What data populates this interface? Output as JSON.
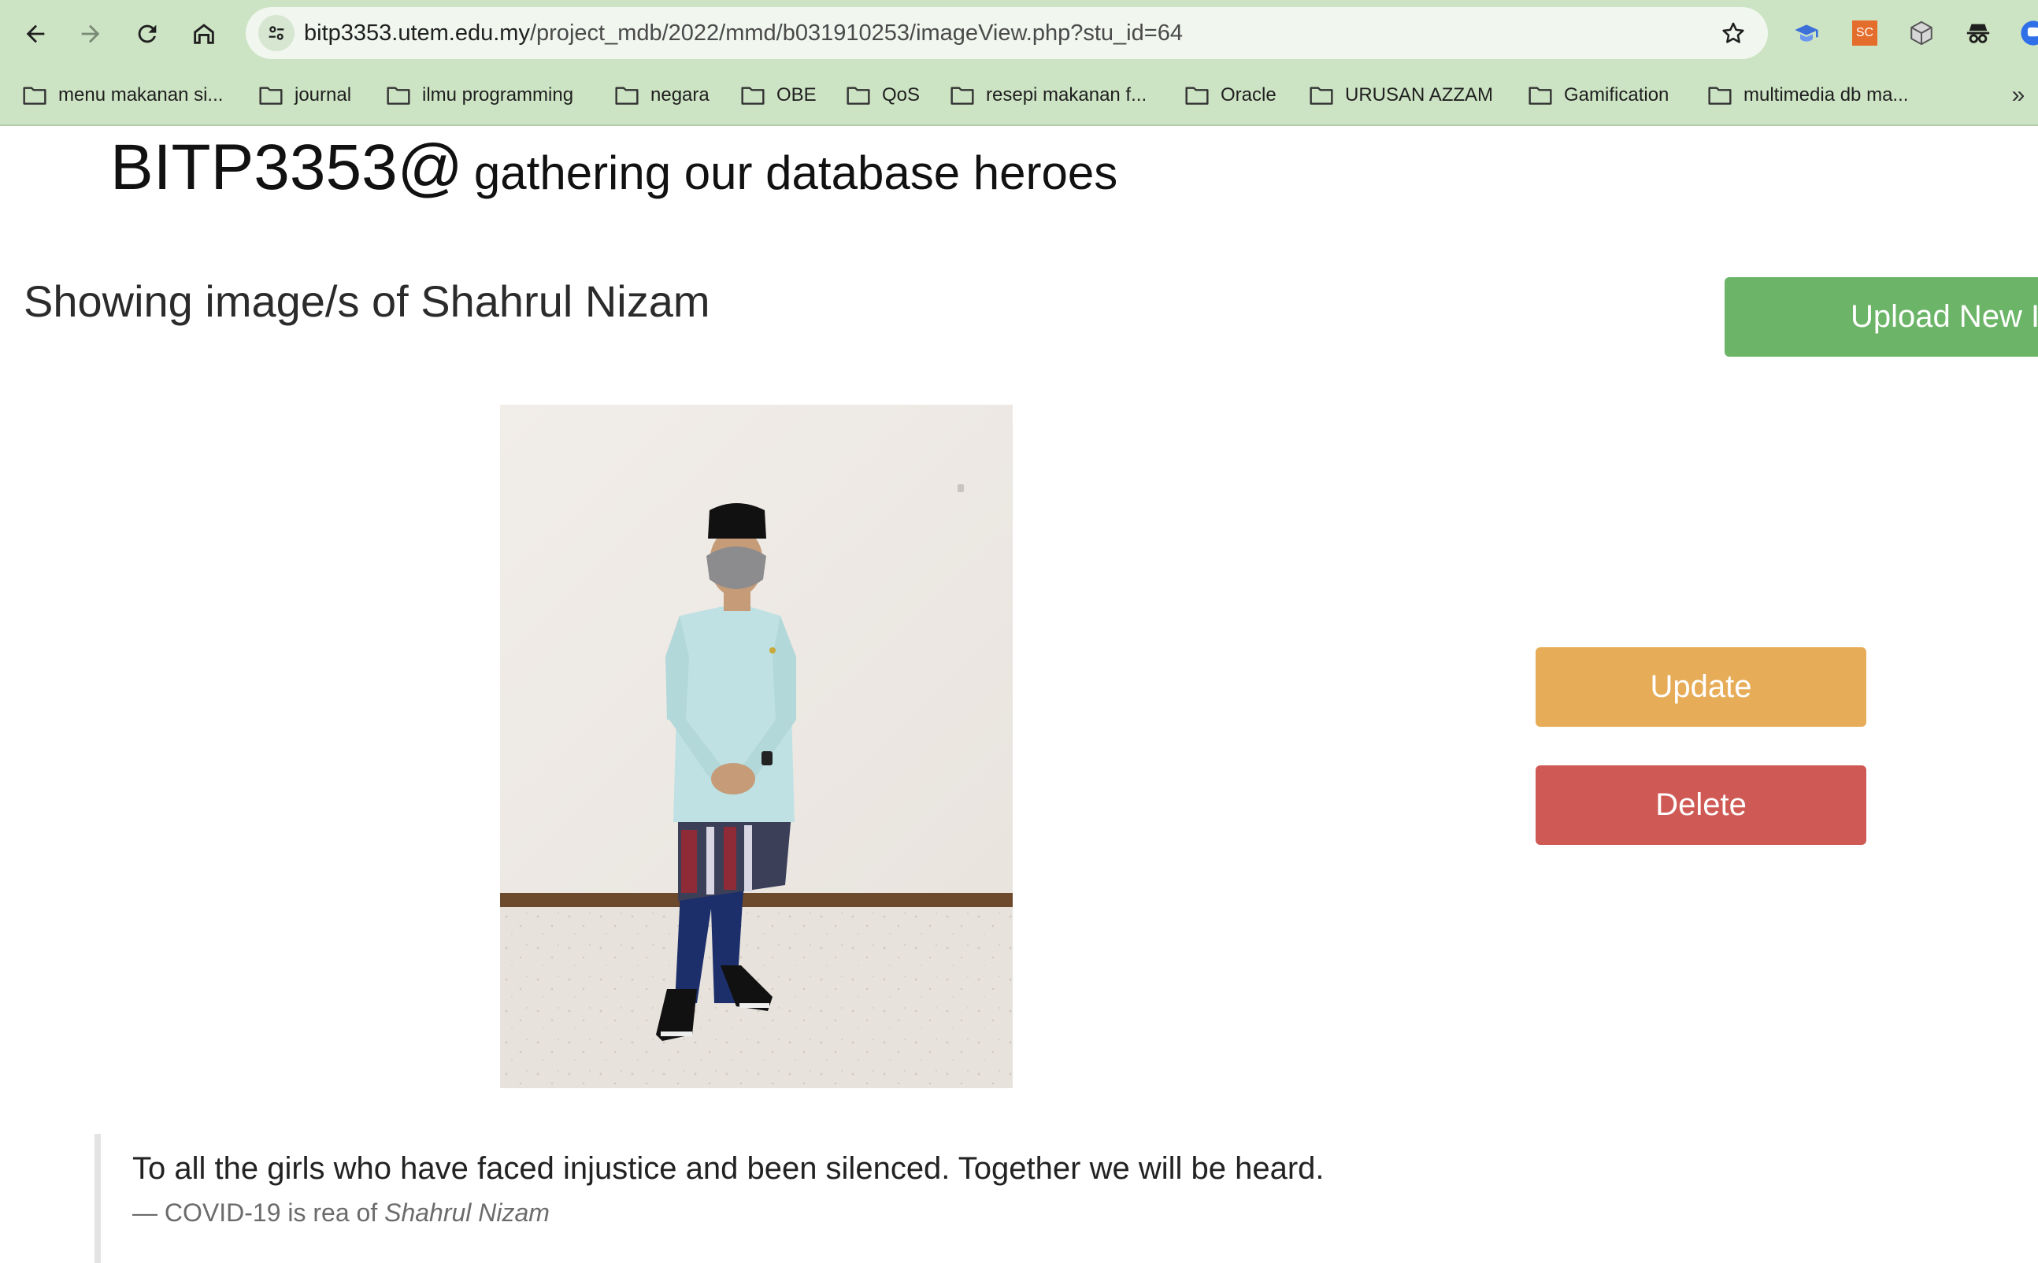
{
  "browser": {
    "url_host": "bitp3353.utem.edu.my",
    "url_path": "/project_mdb/2022/mmd/b031910253/imageView.php?stu_id=64",
    "extensions": [
      "graduation-cap-icon",
      "sc-extension-icon",
      "cube-extension-icon",
      "spy-extension-icon",
      "chat-extension-icon"
    ],
    "extension_sc_label": "SC",
    "bookmarks": [
      "menu makanan si...",
      "journal",
      "ilmu programming",
      "negara",
      "OBE",
      "QoS",
      "resepi makanan f...",
      "Oracle",
      "URUSAN AZZAM",
      "Gamification",
      "multimedia db ma..."
    ],
    "bookmarks_more": "»"
  },
  "page": {
    "brand_big": "BITP3353@",
    "brand_small": "gathering our database heroes",
    "heading": "Showing image/s of Shahrul Nizam",
    "upload_label": "Upload New I",
    "update_label": "Update",
    "delete_label": "Delete",
    "quote_text": "To all the girls who have faced injustice and been silenced. Together we will be heard.",
    "quote_prefix": "— COVID-19 is rea of ",
    "quote_author": "Shahrul Nizam"
  },
  "colors": {
    "chrome": "#cde4c4",
    "upload": "#6cb568",
    "update": "#e7ac57",
    "delete": "#cf5a55"
  }
}
